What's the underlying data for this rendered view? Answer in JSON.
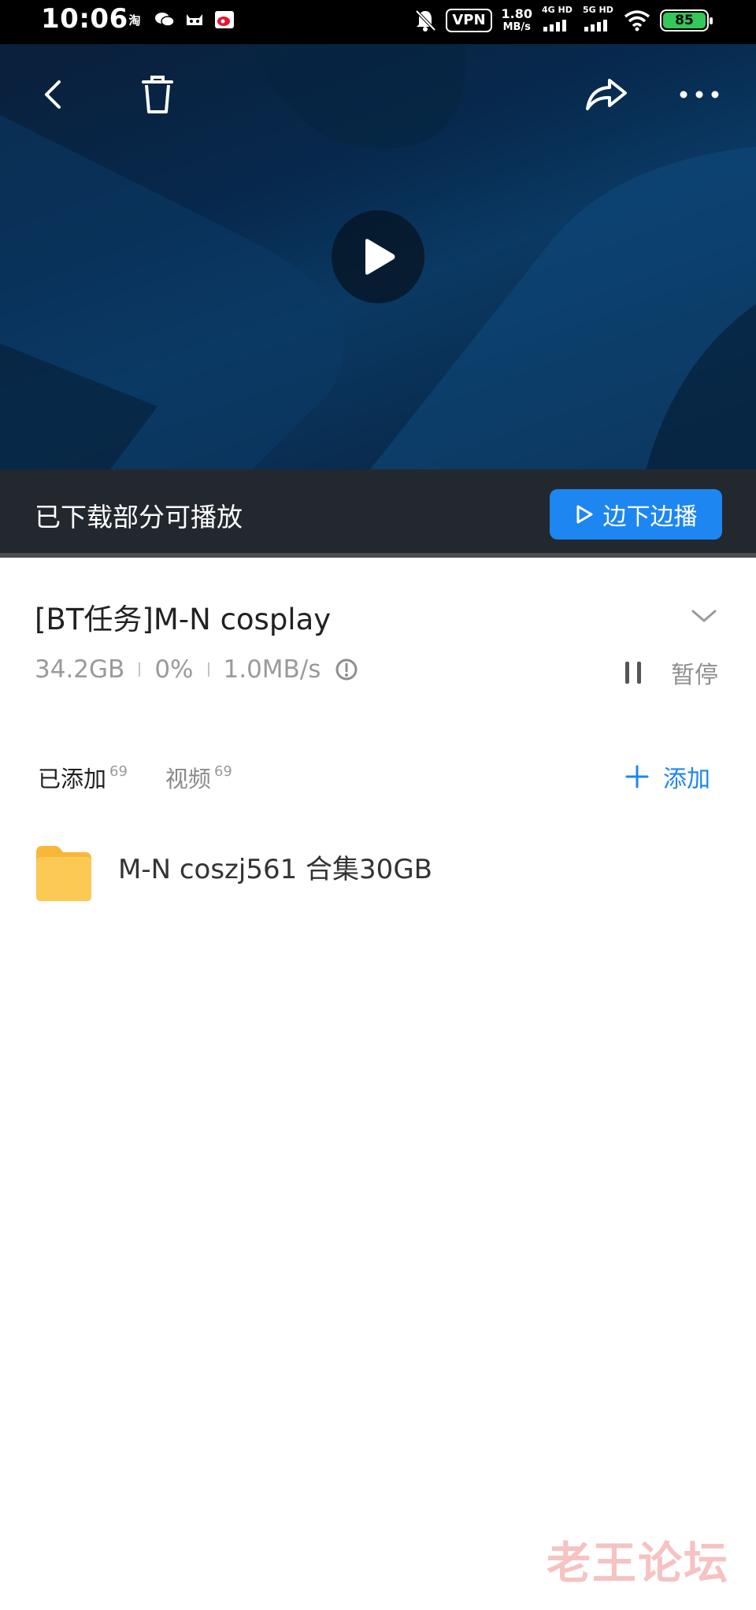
{
  "status_bar": {
    "time": "10:06",
    "apps": [
      "淘",
      "wechat-icon",
      "cat-icon",
      "weibo-icon"
    ],
    "vpn": "VPN",
    "speed_value": "1.80",
    "speed_unit": "MB/s",
    "signal1_label": "4G HD",
    "signal2_label": "5G HD",
    "battery": "85",
    "battery_color": "#35c759"
  },
  "video": {
    "partial_label": "已下载部分可播放",
    "stream_label": "边下边播"
  },
  "task": {
    "title": "[BT任务]M-N cosplay",
    "size": "34.2GB",
    "progress": "0%",
    "speed": "1.0MB/s",
    "pause_label": "暂停"
  },
  "tabs": [
    {
      "label": "已添加",
      "count": "69"
    },
    {
      "label": "视频",
      "count": "69"
    }
  ],
  "add_label": "添加",
  "files": [
    {
      "name": "M-N coszj561 合集30GB",
      "icon": "folder-icon"
    }
  ],
  "watermark": "老王论坛",
  "colors": {
    "accent": "#1d86f0",
    "folder": "#fbc14d",
    "play_bar": "#23282f"
  }
}
